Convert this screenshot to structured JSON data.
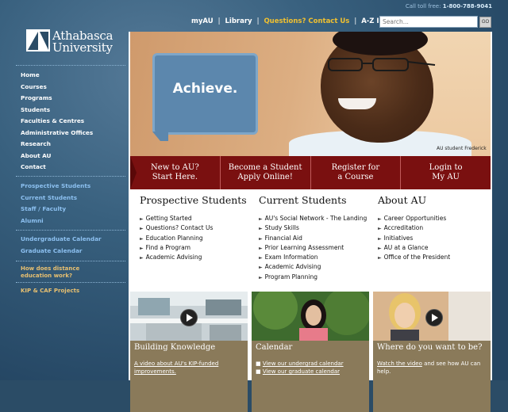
{
  "header": {
    "toll_free_label": "Call toll free:",
    "toll_free_number": "1-800-788-9041",
    "nav": [
      "myAU",
      "Library",
      "Questions? Contact Us",
      "A-Z Index"
    ],
    "search_placeholder": "Search...",
    "go_label": "GO"
  },
  "logo": {
    "line1": "Athabasca",
    "line2": "University"
  },
  "sidebar": {
    "primary": [
      "Home",
      "Courses",
      "Programs",
      "Students",
      "Faculties & Centres",
      "Administrative Offices",
      "Research",
      "About AU",
      "Contact"
    ],
    "audience": [
      "Prospective Students",
      "Current Students",
      "Staff / Faculty",
      "Alumni"
    ],
    "calendars": [
      "Undergraduate Calendar",
      "Graduate Calendar"
    ],
    "distance_line1": "How does distance",
    "distance_line2": "education work?",
    "projects": "KIP & CAF Projects"
  },
  "hero": {
    "headline": "Achieve.",
    "caption": "AU student Frederick"
  },
  "cta": [
    {
      "line1": "New to AU?",
      "line2": "Start Here."
    },
    {
      "line1": "Become a Student",
      "line2": "Apply Online!"
    },
    {
      "line1": "Register for",
      "line2": "a Course"
    },
    {
      "line1": "Login to",
      "line2": "My AU"
    }
  ],
  "columns": [
    {
      "title": "Prospective Students",
      "items": [
        "Getting Started",
        "Questions? Contact Us",
        "Education Planning",
        "Find a Program",
        "Academic Advising"
      ]
    },
    {
      "title": "Current Students",
      "items": [
        "AU's Social Network - The Landing",
        "Study Skills",
        "Financial Aid",
        "Prior Learning Assessment",
        "Exam Information",
        "Academic Advising",
        "Program Planning"
      ]
    },
    {
      "title": "About AU",
      "items": [
        "Career Opportunities",
        "Accreditation",
        "Initiatives",
        "AU at a Glance",
        "Office of the President"
      ]
    }
  ],
  "cards": [
    {
      "title": "Building Knowledge",
      "link1": "A video about AU's KIP-funded",
      "link2": "improvements."
    },
    {
      "title": "Calendar",
      "link1": "View our undergrad calendar",
      "link2": "View our graduate calendar"
    },
    {
      "title": "Where do you want to be?",
      "link1": "Watch the video",
      "text1": " and see how AU can",
      "text2": "help."
    }
  ],
  "colors": {
    "brand_blue": "#2b4c66",
    "cta_red": "#7a1010",
    "card_tan": "#8a7a5a",
    "contact_gold": "#f0c030"
  }
}
